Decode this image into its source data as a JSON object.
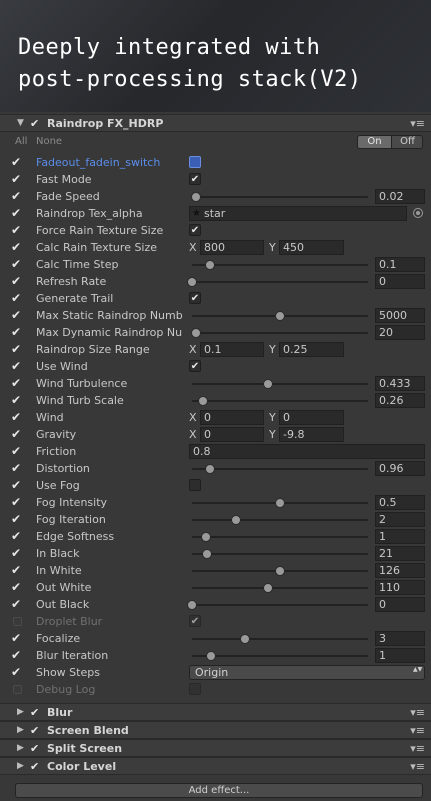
{
  "hero": {
    "title": "Deeply integrated with\npost-processing stack(V2)"
  },
  "effect": {
    "title": "Raindrop FX_HDRP",
    "all_label": "All",
    "none_label": "None",
    "on_label": "On",
    "off_label": "Off"
  },
  "rows": {
    "fadeout": {
      "label": "Fadeout_fadein_switch"
    },
    "fast_mode": {
      "label": "Fast Mode"
    },
    "fade_speed": {
      "label": "Fade Speed",
      "value": "0.02",
      "level": 0.02
    },
    "raindrop_tex": {
      "label": "Raindrop Tex_alpha",
      "value": "star",
      "icon": "texture-icon"
    },
    "force_rain": {
      "label": "Force Rain Texture Size"
    },
    "calc_rain_size": {
      "label": "Calc Rain Texture Size",
      "x_label": "X",
      "x": "800",
      "y_label": "Y",
      "y": "450"
    },
    "calc_time_step": {
      "label": "Calc Time Step",
      "value": "0.1",
      "level": 0.1
    },
    "refresh_rate": {
      "label": "Refresh Rate",
      "value": "0",
      "level": 0
    },
    "generate_trail": {
      "label": "Generate Trail"
    },
    "max_static": {
      "label": "Max Static Raindrop Numb",
      "value": "5000",
      "level": 0.5
    },
    "max_dynamic": {
      "label": "Max Dynamic Raindrop Nu",
      "value": "20",
      "level": 0.02
    },
    "size_range": {
      "label": "Raindrop Size Range",
      "x_label": "X",
      "x": "0.1",
      "y_label": "Y",
      "y": "0.25"
    },
    "use_wind": {
      "label": "Use Wind"
    },
    "wind_turbulence": {
      "label": "Wind Turbulence",
      "value": "0.433",
      "level": 0.433
    },
    "wind_turb_scale": {
      "label": "Wind Turb Scale",
      "value": "0.26",
      "level": 0.06
    },
    "wind": {
      "label": "Wind",
      "x_label": "X",
      "x": "0",
      "y_label": "Y",
      "y": "0"
    },
    "gravity": {
      "label": "Gravity",
      "x_label": "X",
      "x": "0",
      "y_label": "Y",
      "y": "-9.8"
    },
    "friction": {
      "label": "Friction",
      "value": "0.8"
    },
    "distortion": {
      "label": "Distortion",
      "value": "0.96",
      "level": 0.1
    },
    "use_fog": {
      "label": "Use Fog"
    },
    "fog_intensity": {
      "label": "Fog Intensity",
      "value": "0.5",
      "level": 0.5
    },
    "fog_iteration": {
      "label": "Fog Iteration",
      "value": "2",
      "level": 0.25
    },
    "edge_softness": {
      "label": "Edge Softness",
      "value": "1",
      "level": 0.08
    },
    "in_black": {
      "label": "In Black",
      "value": "21",
      "level": 0.085
    },
    "in_white": {
      "label": "In White",
      "value": "126",
      "level": 0.5
    },
    "out_white": {
      "label": "Out White",
      "value": "110",
      "level": 0.43
    },
    "out_black": {
      "label": "Out Black",
      "value": "0",
      "level": 0
    },
    "droplet_blur": {
      "label": "Droplet Blur"
    },
    "focalize": {
      "label": "Focalize",
      "value": "3",
      "level": 0.3
    },
    "blur_iteration": {
      "label": "Blur Iteration",
      "value": "1",
      "level": 0.11
    },
    "show_steps": {
      "label": "Show Steps",
      "value": "Origin"
    },
    "debug_log": {
      "label": "Debug Log"
    }
  },
  "effects": [
    {
      "title": "Blur"
    },
    {
      "title": "Screen Blend"
    },
    {
      "title": "Split Screen"
    },
    {
      "title": "Color Level"
    }
  ],
  "add_effect_label": "Add effect..."
}
